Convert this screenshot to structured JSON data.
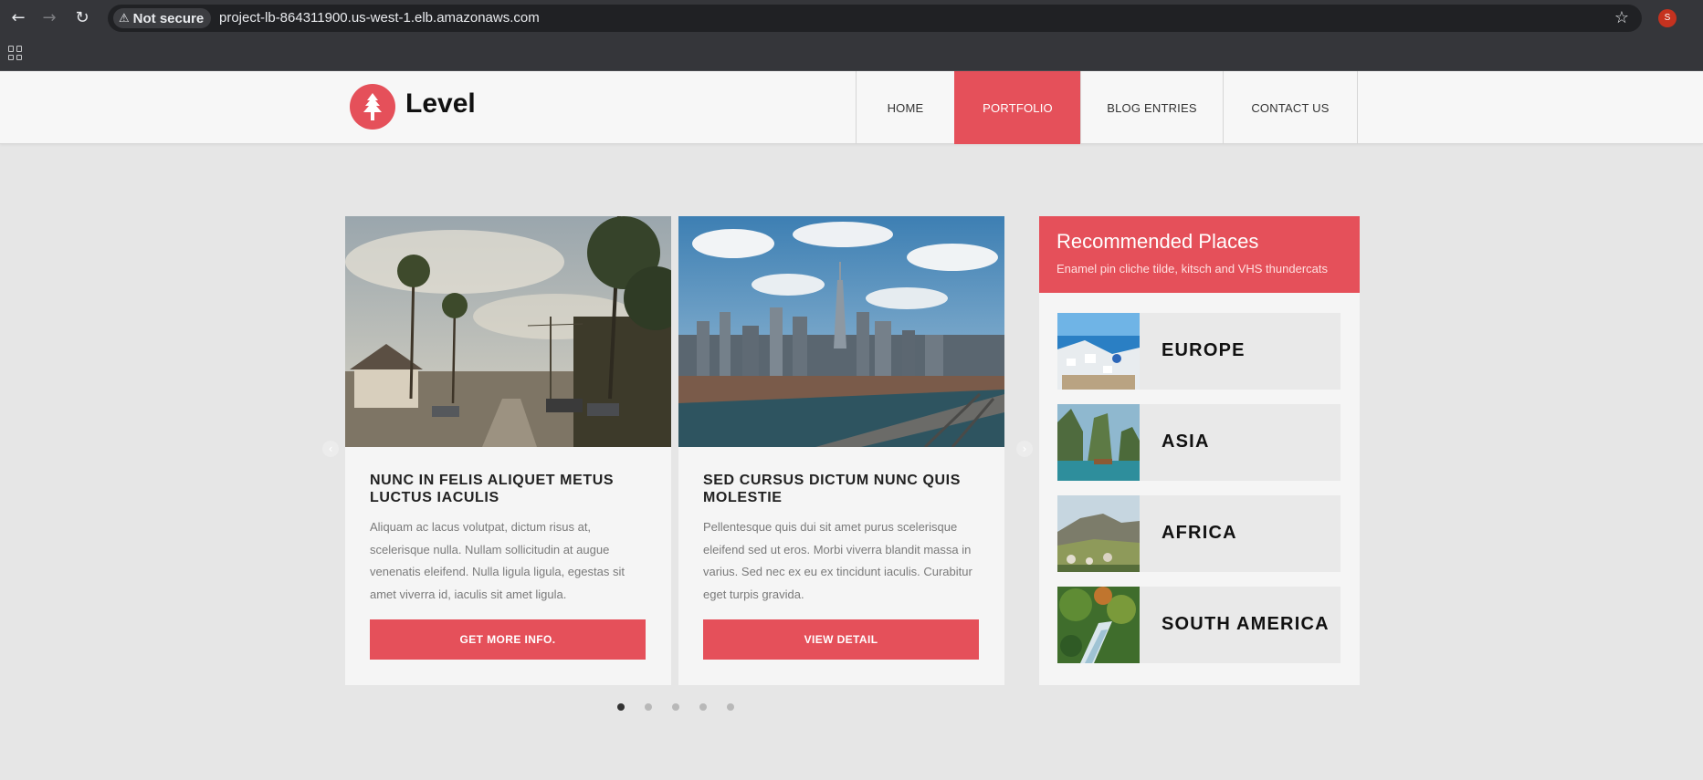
{
  "browser": {
    "security_label": "Not secure",
    "url": "project-lb-864311900.us-west-1.elb.amazonaws.com",
    "profile_initial": "S"
  },
  "header": {
    "logo_text": "Level",
    "nav": [
      "HOME",
      "PORTFOLIO",
      "BLOG ENTRIES",
      "CONTACT US"
    ],
    "active_nav": "PORTFOLIO",
    "accent_color": "#e5505a"
  },
  "cards": [
    {
      "title": "NUNC IN FELIS ALIQUET METUS LUCTUS IACULIS",
      "text": "Aliquam ac lacus volutpat, dictum risus at, scelerisque nulla. Nullam sollicitudin at augue venenatis eleifend. Nulla ligula ligula, egestas sit amet viverra id, iaculis sit amet ligula.",
      "button": "GET MORE INFO."
    },
    {
      "title": "SED CURSUS DICTUM NUNC QUIS MOLESTIE",
      "text": "Pellentesque quis dui sit amet purus scelerisque eleifend sed ut eros. Morbi viverra blandit massa in varius. Sed nec ex eu ex tincidunt iaculis. Curabitur eget turpis gravida.",
      "button": "VIEW DETAIL"
    }
  ],
  "slider": {
    "dot_count": 5,
    "active_dot": 1
  },
  "sidebar": {
    "title": "Recommended Places",
    "subtitle": "Enamel pin cliche tilde, kitsch and VHS thundercats",
    "places": [
      "EUROPE",
      "ASIA",
      "AFRICA",
      "SOUTH AMERICA"
    ]
  }
}
